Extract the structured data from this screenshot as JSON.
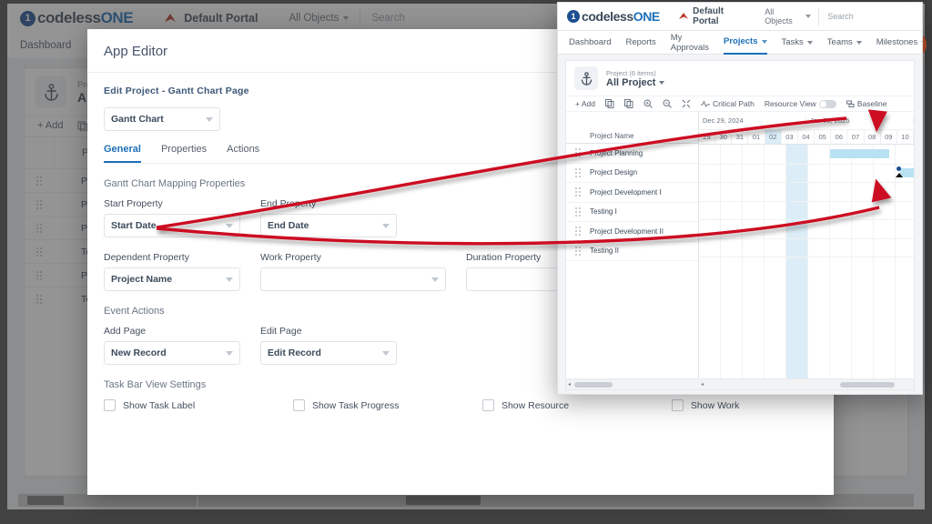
{
  "brand": {
    "name_light": "codeless",
    "name_bold": "ONE",
    "mark": "1"
  },
  "topbar": {
    "portal_label": "Default Portal",
    "objects_label": "All Objects",
    "search_placeholder": "Search"
  },
  "nav": {
    "items": [
      {
        "label": "Dashboard",
        "active": false,
        "caret": false
      },
      {
        "label": "Reports",
        "active": false,
        "caret": false
      },
      {
        "label": "My Approvals",
        "active": false,
        "caret": false
      },
      {
        "label": "Projects",
        "active": true,
        "caret": true
      },
      {
        "label": "Tasks",
        "active": false,
        "caret": true
      },
      {
        "label": "Teams",
        "active": false,
        "caret": true
      },
      {
        "label": "Milestones",
        "active": false,
        "caret": true
      }
    ]
  },
  "record": {
    "subtitle": "Project (6 items)",
    "title": "All Project",
    "icon": "anchor-icon"
  },
  "toolbar": {
    "add_label": "+ Add",
    "copy_icon": "copy-icon",
    "duplicate_icon": "duplicate-icon",
    "zoom_in_icon": "zoom-in-icon",
    "zoom_out_icon": "zoom-out-icon",
    "fit_icon": "fit-screen-icon",
    "critical_path_label": "Critical Path",
    "critical_path_icon": "activity-icon",
    "resource_view_label": "Resource View",
    "resource_view_on": false,
    "baseline_label": "Baseline",
    "baseline_icon": "baseline-icon"
  },
  "grid": {
    "column_header": "Project Name",
    "rows": [
      {
        "name": "Project Planning"
      },
      {
        "name": "Project Design"
      },
      {
        "name": "Project Development I"
      },
      {
        "name": "Testing I"
      },
      {
        "name": "Project Development II"
      },
      {
        "name": "Testing II"
      }
    ]
  },
  "timeline": {
    "months": [
      {
        "label": "Dec 29, 2024",
        "span": 7
      },
      {
        "label": "Jan 05, 2025",
        "span": 7
      }
    ],
    "days": [
      "29",
      "30",
      "31",
      "01",
      "02",
      "03",
      "04",
      "05",
      "06",
      "07",
      "08",
      "09",
      "10"
    ],
    "today_index": 4,
    "bars": [
      {
        "row": 0,
        "start_index": 6,
        "span": 2.7,
        "color": "#b8e2f2"
      },
      {
        "row": 1,
        "start_index": 9.2,
        "span": 2.8,
        "color": "#b8e2f2"
      }
    ],
    "milestone": {
      "row": 1,
      "index": 9.05,
      "marker": "diamond-handle"
    }
  },
  "app_editor": {
    "title": "App Editor",
    "breadcrumb": "Edit Project  -  Gantt Chart  Page",
    "page_select": "Gantt Chart",
    "tabs": [
      {
        "label": "General",
        "active": true
      },
      {
        "label": "Properties",
        "active": false
      },
      {
        "label": "Actions",
        "active": false
      }
    ],
    "mapping_section": "Gantt Chart Mapping Properties",
    "fields": [
      {
        "label": "Start Property",
        "value": "Start Date"
      },
      {
        "label": "End Property",
        "value": "End Date"
      },
      {
        "label": "Dependent Property",
        "value": "Project Name"
      },
      {
        "label": "Work Property",
        "value": ""
      },
      {
        "label": "Duration Property",
        "value": ""
      }
    ],
    "event_section": "Event Actions",
    "event_fields": [
      {
        "label": "Add Page",
        "value": "New Record"
      },
      {
        "label": "Edit Page",
        "value": "Edit Record"
      }
    ],
    "taskbar_section": "Task Bar View Settings",
    "checkboxes": [
      {
        "label": "Show Task Label",
        "checked": false
      },
      {
        "label": "Show Task Progress",
        "checked": false
      },
      {
        "label": "Show Resource",
        "checked": false
      },
      {
        "label": "Show Work",
        "checked": false
      }
    ]
  },
  "fab": {
    "icon": "pencil-icon",
    "color": "#c0532a"
  },
  "colors": {
    "accent": "#1d6fb8",
    "brand_dark": "#3b4a5a",
    "bar": "#b8e2f2",
    "today": "#dcedf7",
    "annotation": "#cc1122"
  }
}
